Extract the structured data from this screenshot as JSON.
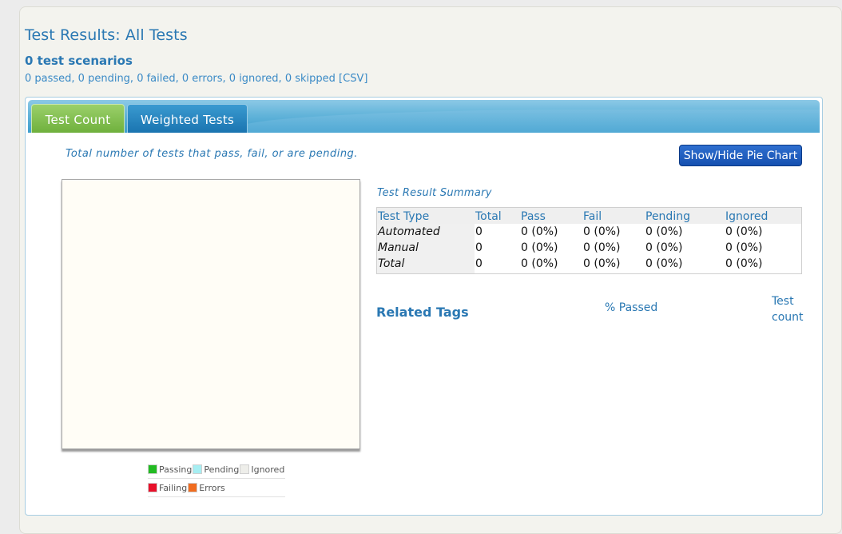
{
  "header": {
    "title": "Test Results: All Tests",
    "scenarios": "0 test scenarios",
    "summary": "0 passed, 0 pending, 0 failed, 0 errors, 0 ignored, 0 skipped",
    "csv_link": "[CSV]"
  },
  "tabs": [
    {
      "label": "Test Count",
      "active": true
    },
    {
      "label": "Weighted Tests",
      "active": false
    }
  ],
  "chart": {
    "description": "Total number of tests that pass, fail, or are pending.",
    "toggle_label": "Show/Hide Pie Chart"
  },
  "legend": [
    {
      "label": "Passing",
      "color": "#22bb22"
    },
    {
      "label": "Pending",
      "color": "#a6eef2"
    },
    {
      "label": "Ignored",
      "color": "#eeeeea"
    },
    {
      "label": "Failing",
      "color": "#e8102a"
    },
    {
      "label": "Errors",
      "color": "#f06c20"
    }
  ],
  "summary_table": {
    "title": "Test Result Summary",
    "columns": [
      "Test Type",
      "Total",
      "Pass",
      "Fail",
      "Pending",
      "Ignored"
    ],
    "rows": [
      [
        "Automated",
        "0",
        "0 (0%)",
        "0 (0%)",
        "0 (0%)",
        "0 (0%)"
      ],
      [
        "Manual",
        "0",
        "0 (0%)",
        "0 (0%)",
        "0 (0%)",
        "0 (0%)"
      ],
      [
        "Total",
        "0",
        "0 (0%)",
        "0 (0%)",
        "0 (0%)",
        "0 (0%)"
      ]
    ]
  },
  "related_tags": {
    "title": "Related Tags",
    "passed_header": "% Passed",
    "count_header_line1": "Test",
    "count_header_line2": "count"
  }
}
